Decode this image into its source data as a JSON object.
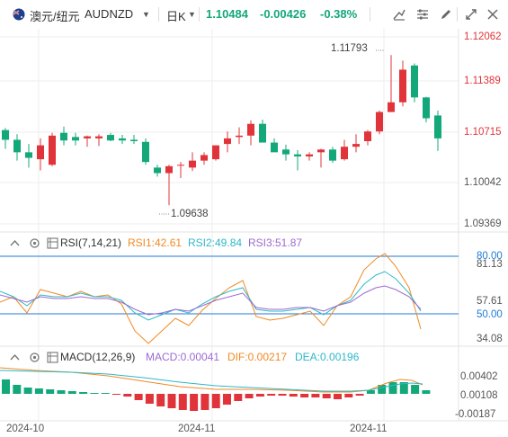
{
  "header": {
    "symbol_name": "澳元/纽元",
    "symbol_code": "AUDNZD",
    "period": "日K",
    "last_price": "1.10484",
    "change": "-0.00426",
    "change_pct": "-0.38%",
    "icons": [
      "flag-icon",
      "dropdown-caret-icon",
      "draw-line-icon",
      "settings-sliders-icon",
      "pen-tool-icon",
      "layers-icon",
      "fullscreen-icon",
      "close-icon"
    ]
  },
  "main_axis": {
    "labels": [
      "1.12062",
      "1.11389",
      "1.10715",
      "1.10042",
      "1.09369"
    ],
    "values": [
      1.12062,
      1.11389,
      1.10715,
      1.10042,
      1.09369
    ],
    "high_marker": "1.11793",
    "low_marker": "1.09638"
  },
  "rsi": {
    "title": "RSI(7,14,21)",
    "rsi1": "RSI1:42.61",
    "rsi2": "RSI2:49.84",
    "rsi3": "RSI3:51.87",
    "axis_labels": [
      "81.13",
      "57.61",
      "34.08"
    ],
    "level_labels": [
      "80.00",
      "50.00"
    ],
    "colors": {
      "rsi1": "#f08a24",
      "rsi2": "#2fb8c8",
      "rsi3": "#9b6bd0",
      "level": "#1f7ad6"
    }
  },
  "macd": {
    "title": "MACD(12,26,9)",
    "macd": "MACD:0.00041",
    "dif": "DIF:0.00217",
    "dea": "DEA:0.00196",
    "axis_labels": [
      "0.00402",
      "0.00108",
      "-0.00187"
    ],
    "colors": {
      "macd": "#9b6bd0",
      "dif": "#f08a24",
      "dea": "#2fb8c8"
    }
  },
  "date_axis": [
    "2024-10",
    "2024-11",
    "2024-11"
  ],
  "colors": {
    "up": "#e0343a",
    "down": "#13a87a",
    "grid": "#eeeeee",
    "panel_border": "#e3e3e3"
  },
  "chart_data": {
    "type": "candlestick",
    "symbol": "AUDNZD",
    "ylim": [
      1.0937,
      1.1206
    ],
    "candles": [
      {
        "o": 1.1072,
        "h": 1.1075,
        "l": 1.1045,
        "c": 1.1058
      },
      {
        "o": 1.1058,
        "h": 1.1066,
        "l": 1.1028,
        "c": 1.104
      },
      {
        "o": 1.104,
        "h": 1.1052,
        "l": 1.1018,
        "c": 1.1032
      },
      {
        "o": 1.103,
        "h": 1.106,
        "l": 1.1014,
        "c": 1.105
      },
      {
        "o": 1.1022,
        "h": 1.1068,
        "l": 1.102,
        "c": 1.1064
      },
      {
        "o": 1.1068,
        "h": 1.1077,
        "l": 1.105,
        "c": 1.1057
      },
      {
        "o": 1.1062,
        "h": 1.1068,
        "l": 1.105,
        "c": 1.1057
      },
      {
        "o": 1.106,
        "h": 1.1064,
        "l": 1.1048,
        "c": 1.1063
      },
      {
        "o": 1.106,
        "h": 1.1066,
        "l": 1.1049,
        "c": 1.1063
      },
      {
        "o": 1.1065,
        "h": 1.1068,
        "l": 1.1056,
        "c": 1.1057
      },
      {
        "o": 1.106,
        "h": 1.1065,
        "l": 1.1052,
        "c": 1.1057
      },
      {
        "o": 1.1058,
        "h": 1.1065,
        "l": 1.1052,
        "c": 1.1056
      },
      {
        "o": 1.1055,
        "h": 1.106,
        "l": 1.1022,
        "c": 1.1026
      },
      {
        "o": 1.1018,
        "h": 1.1022,
        "l": 1.1005,
        "c": 1.101
      },
      {
        "o": 1.101,
        "h": 1.1022,
        "l": 1.0964,
        "c": 1.102
      },
      {
        "o": 1.1022,
        "h": 1.1026,
        "l": 1.1003,
        "c": 1.1022
      },
      {
        "o": 1.1018,
        "h": 1.104,
        "l": 1.1013,
        "c": 1.1028
      },
      {
        "o": 1.1028,
        "h": 1.104,
        "l": 1.1022,
        "c": 1.1036
      },
      {
        "o": 1.103,
        "h": 1.105,
        "l": 1.1028,
        "c": 1.105
      },
      {
        "o": 1.1052,
        "h": 1.107,
        "l": 1.104,
        "c": 1.106
      },
      {
        "o": 1.1062,
        "h": 1.1076,
        "l": 1.1052,
        "c": 1.1064
      },
      {
        "o": 1.1064,
        "h": 1.1086,
        "l": 1.105,
        "c": 1.1081
      },
      {
        "o": 1.1081,
        "h": 1.1087,
        "l": 1.107,
        "c": 1.1054
      },
      {
        "o": 1.1054,
        "h": 1.106,
        "l": 1.1044,
        "c": 1.104
      },
      {
        "o": 1.1044,
        "h": 1.1051,
        "l": 1.1028,
        "c": 1.1037
      },
      {
        "o": 1.1037,
        "h": 1.1043,
        "l": 1.1014,
        "c": 1.1034
      },
      {
        "o": 1.1034,
        "h": 1.104,
        "l": 1.1028,
        "c": 1.1037
      },
      {
        "o": 1.104,
        "h": 1.1045,
        "l": 1.1018,
        "c": 1.1044
      },
      {
        "o": 1.1044,
        "h": 1.1048,
        "l": 1.1025,
        "c": 1.1028
      },
      {
        "o": 1.103,
        "h": 1.1058,
        "l": 1.1028,
        "c": 1.1048
      },
      {
        "o": 1.1048,
        "h": 1.1066,
        "l": 1.104,
        "c": 1.1052
      },
      {
        "o": 1.1056,
        "h": 1.1072,
        "l": 1.105,
        "c": 1.107
      },
      {
        "o": 1.107,
        "h": 1.11,
        "l": 1.1066,
        "c": 1.1098
      },
      {
        "o": 1.1098,
        "h": 1.118,
        "l": 1.1098,
        "c": 1.1112
      },
      {
        "o": 1.1112,
        "h": 1.1172,
        "l": 1.1106,
        "c": 1.1159
      },
      {
        "o": 1.1165,
        "h": 1.1168,
        "l": 1.1112,
        "c": 1.1119
      },
      {
        "o": 1.1119,
        "h": 1.112,
        "l": 1.1083,
        "c": 1.1089
      },
      {
        "o": 1.1093,
        "h": 1.11,
        "l": 1.1042,
        "c": 1.106
      }
    ]
  }
}
